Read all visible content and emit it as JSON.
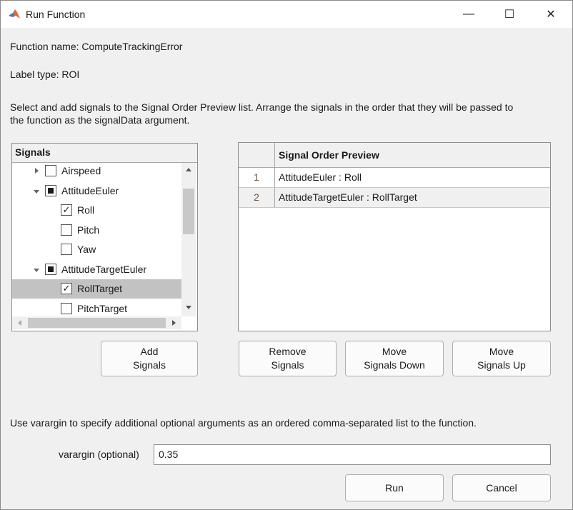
{
  "window": {
    "title": "Run Function",
    "minimize": "—",
    "maximize": "☐",
    "close": "✕"
  },
  "function_name": "Function name: ComputeTrackingError",
  "label_type": "Label type: ROI",
  "instructions_line1": "Select and add signals to the Signal Order Preview list. Arrange the signals in the order that they will be passed to",
  "instructions_line2": "the function as the signalData argument.",
  "signals": {
    "header": "Signals",
    "items": [
      {
        "label": "Airspeed",
        "level": 0,
        "expander": "collapsed",
        "state": "unchecked"
      },
      {
        "label": "AttitudeEuler",
        "level": 0,
        "expander": "expanded",
        "state": "partial"
      },
      {
        "label": "Roll",
        "level": 1,
        "state": "checked"
      },
      {
        "label": "Pitch",
        "level": 1,
        "state": "unchecked"
      },
      {
        "label": "Yaw",
        "level": 1,
        "state": "unchecked"
      },
      {
        "label": "AttitudeTargetEuler",
        "level": 0,
        "expander": "expanded",
        "state": "partial"
      },
      {
        "label": "RollTarget",
        "level": 1,
        "state": "checked",
        "selected": true
      },
      {
        "label": "PitchTarget",
        "level": 1,
        "state": "unchecked"
      }
    ]
  },
  "preview": {
    "header": "Signal Order Preview",
    "rows": [
      {
        "index": "1",
        "signal": "AttitudeEuler : Roll"
      },
      {
        "index": "2",
        "signal": "AttitudeTargetEuler : RollTarget"
      }
    ]
  },
  "buttons": {
    "add": [
      "Add",
      "Signals"
    ],
    "remove": [
      "Remove",
      "Signals"
    ],
    "move_down": [
      "Move",
      "Signals Down"
    ],
    "move_up": [
      "Move",
      "Signals Up"
    ],
    "run": "Run",
    "cancel": "Cancel"
  },
  "varargin_note": "Use varargin to specify additional optional arguments as an ordered comma-separated list to the function.",
  "varargin_label": "varargin (optional)",
  "varargin_value": "0.35"
}
